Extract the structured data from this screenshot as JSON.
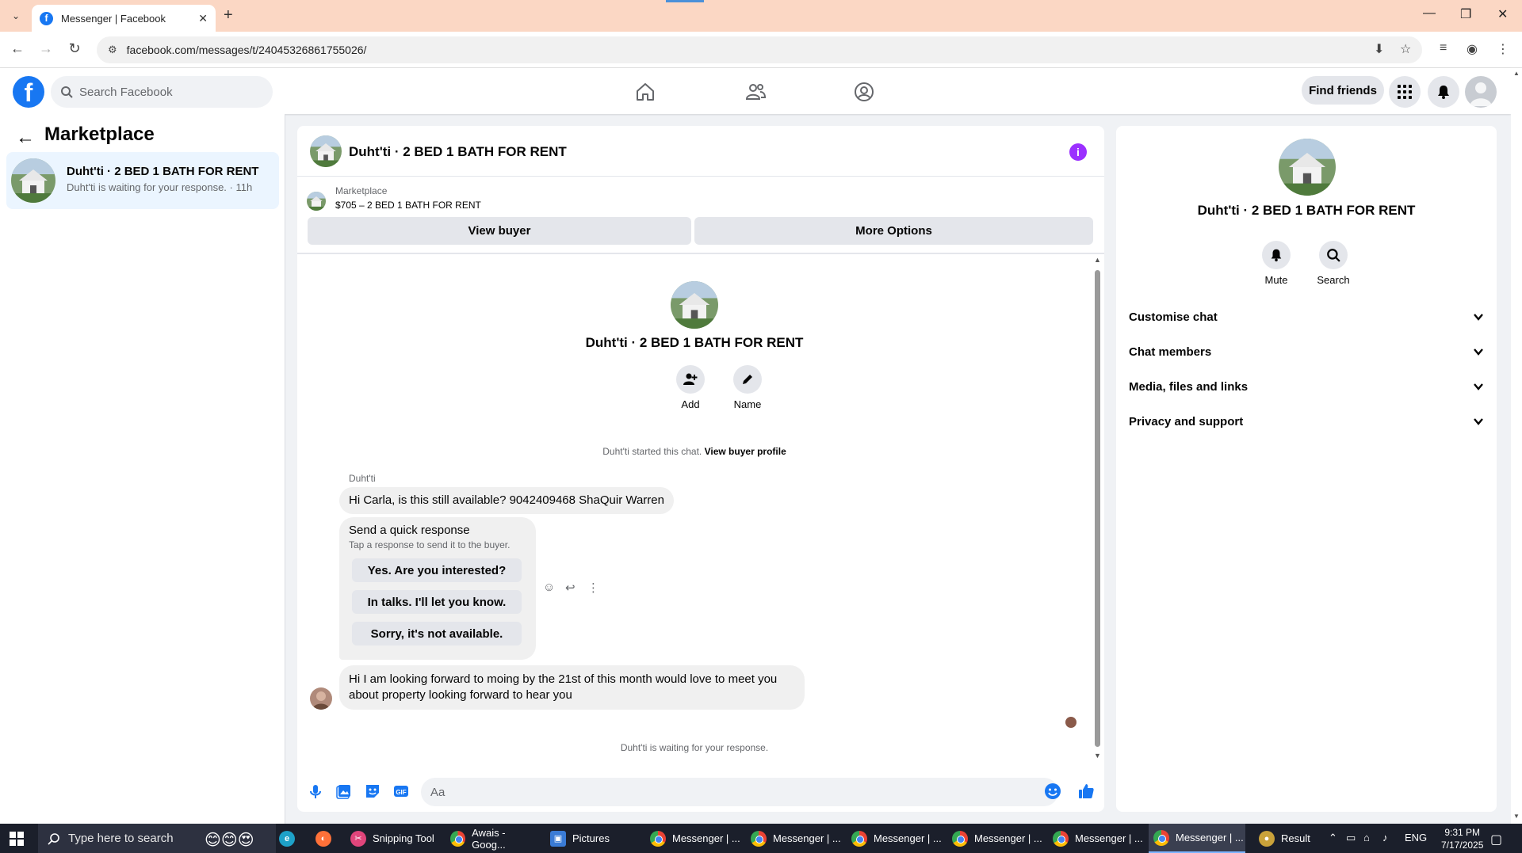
{
  "browser": {
    "tab_title": "Messenger | Facebook",
    "url": "facebook.com/messages/t/24045326861755026/"
  },
  "header": {
    "search_placeholder": "Search Facebook",
    "find_friends": "Find friends"
  },
  "sidebar": {
    "title": "Marketplace",
    "conversation": {
      "name": "Duht'ti · 2 BED 1 BATH FOR RENT",
      "snippet": "Duht'ti is waiting for your response. · 11h"
    }
  },
  "chat": {
    "title": "Duht'ti · 2 BED 1 BATH FOR RENT",
    "listing_source": "Marketplace",
    "listing_price": "$705 – 2 BED 1 BATH FOR RENT",
    "view_buyer": "View buyer",
    "more_options": "More Options",
    "profile_name": "Duht'ti · 2 BED 1 BATH FOR RENT",
    "add_label": "Add",
    "name_label": "Name",
    "started_text": "Duht'ti started this chat.",
    "view_buyer_profile": "View buyer profile",
    "sender": "Duht'ti",
    "message1": "Hi Carla, is this still available? 9042409468 ShaQuir Warren",
    "quick_response": {
      "heading": "Send a quick response",
      "sub": "Tap a response to send it to the buyer.",
      "options": [
        "Yes. Are you interested?",
        "In talks. I'll let you know.",
        "Sorry, it's not available."
      ]
    },
    "message2": "Hi I am looking forward to moing by the 21st of this month would love to meet you about property looking forward to hear you",
    "waiting": "Duht'ti is waiting for your response.",
    "composer_placeholder": "Aa"
  },
  "details": {
    "name": "Duht'ti · 2 BED 1 BATH FOR RENT",
    "mute": "Mute",
    "search": "Search",
    "sections": [
      "Customise chat",
      "Chat members",
      "Media, files and links",
      "Privacy and support"
    ]
  },
  "taskbar": {
    "search_placeholder": "Type here to search",
    "apps": [
      "Snipping Tool",
      "Awais - Goog...",
      "Pictures",
      "Messenger | ...",
      "Messenger | ...",
      "Messenger | ...",
      "Messenger | ...",
      "Messenger | ...",
      "Messenger | ..."
    ],
    "result": "Result",
    "lang": "ENG",
    "time": "9:31 PM",
    "date": "7/17/2025"
  },
  "colors": {
    "fb_blue": "#1877f2",
    "info_purple": "#9b30ff",
    "tab_bar": "#fbd7c4",
    "selected_conv": "#ebf5ff"
  }
}
